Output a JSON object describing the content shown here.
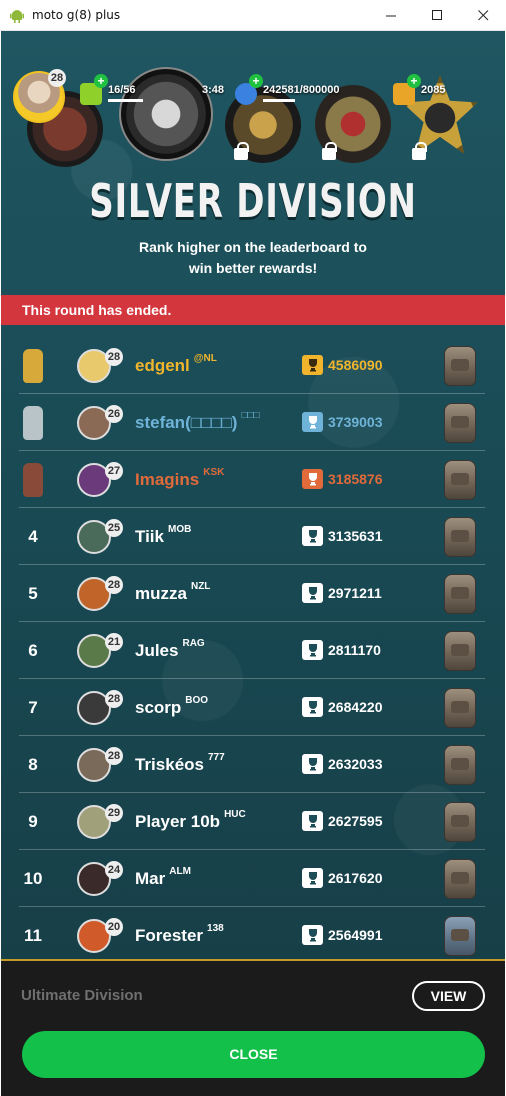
{
  "window": {
    "title": "moto g(8) plus",
    "minimize_icon": "minimize-icon",
    "maximize_icon": "maximize-icon",
    "close_icon": "close-icon"
  },
  "header": {
    "player_level": "28",
    "energy": "16/56",
    "timer": "3:48",
    "xp": "242581/800000",
    "gold": "2085",
    "title": "SILVER DIVISION",
    "subtitle_line1": "Rank higher on the leaderboard to",
    "subtitle_line2": "win better rewards!"
  },
  "banner": {
    "text": "This round has ended."
  },
  "leaderboard": [
    {
      "rank": "",
      "medal": "gold",
      "level": "28",
      "name": "edgenl",
      "tag": "@NL",
      "score": "4586090",
      "name_color": "#f0b52c",
      "avatar_color": "#e8c96b"
    },
    {
      "rank": "",
      "medal": "silver",
      "level": "26",
      "name": "stefan(□□□□)",
      "tag": "□□□",
      "score": "3739003",
      "name_color": "#6fb4d8",
      "avatar_color": "#8a6a55"
    },
    {
      "rank": "",
      "medal": "bronze",
      "level": "27",
      "name": "Imagins",
      "tag": "KSK",
      "score": "3185876",
      "name_color": "#e06a3a",
      "avatar_color": "#6a3a7a"
    },
    {
      "rank": "4",
      "medal": "",
      "level": "25",
      "name": "Tiik",
      "tag": "MOB",
      "score": "3135631",
      "name_color": "#ffffff",
      "avatar_color": "#4a6a5a"
    },
    {
      "rank": "5",
      "medal": "",
      "level": "28",
      "name": "muzza",
      "tag": "NZL",
      "score": "2971211",
      "name_color": "#ffffff",
      "avatar_color": "#c0642a"
    },
    {
      "rank": "6",
      "medal": "",
      "level": "21",
      "name": "Jules",
      "tag": "RAG",
      "score": "2811170",
      "name_color": "#ffffff",
      "avatar_color": "#5a7a4a"
    },
    {
      "rank": "7",
      "medal": "",
      "level": "28",
      "name": "scorp",
      "tag": "BOO",
      "score": "2684220",
      "name_color": "#ffffff",
      "avatar_color": "#3a3a3a"
    },
    {
      "rank": "8",
      "medal": "",
      "level": "28",
      "name": "Triskéos",
      "tag": "777",
      "score": "2632033",
      "name_color": "#ffffff",
      "avatar_color": "#7a6a5a"
    },
    {
      "rank": "9",
      "medal": "",
      "level": "29",
      "name": "Player 10b",
      "tag": "HUC",
      "score": "2627595",
      "name_color": "#ffffff",
      "avatar_color": "#a0a07a"
    },
    {
      "rank": "10",
      "medal": "",
      "level": "24",
      "name": "Mar",
      "tag": "ALM",
      "score": "2617620",
      "name_color": "#ffffff",
      "avatar_color": "#3a2a2a"
    },
    {
      "rank": "11",
      "medal": "",
      "level": "20",
      "name": "Forester",
      "tag": "138",
      "score": "2564991",
      "name_color": "#ffffff",
      "avatar_color": "#d05a2a"
    }
  ],
  "footer": {
    "next_division": "Ultimate Division",
    "view_label": "VIEW",
    "close_label": "CLOSE"
  },
  "colors": {
    "gold": "#f0b52c",
    "silver": "#6fb4d8",
    "bronze": "#e06a3a",
    "banner": "#d4363e",
    "close_button": "#13c04a"
  }
}
